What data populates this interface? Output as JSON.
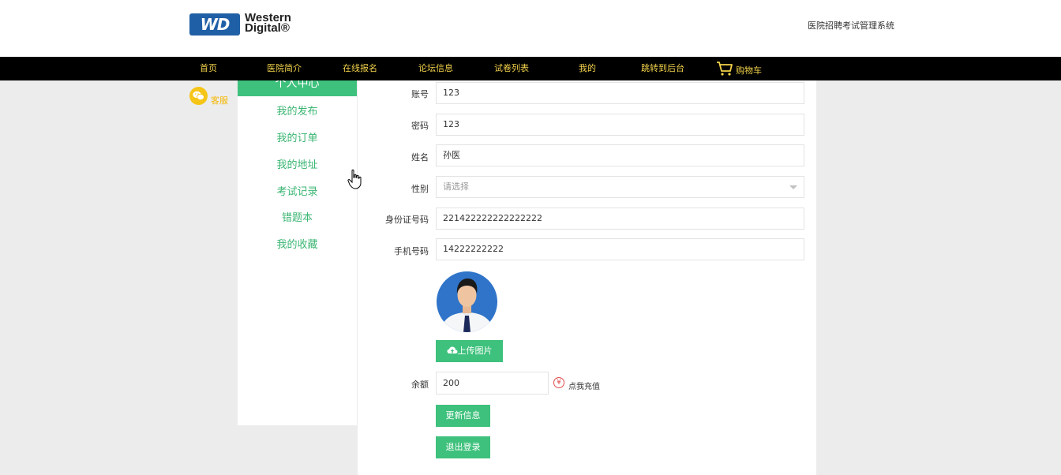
{
  "brand": {
    "logo_badge": "WD",
    "logo_line1": "Western",
    "logo_line2": "Digital®",
    "site_title": "医院招聘考试管理系统"
  },
  "nav": {
    "items": [
      "首页",
      "医院简介",
      "在线报名",
      "论坛信息",
      "试卷列表",
      "我的",
      "跳转到后台",
      "购物车"
    ]
  },
  "service": {
    "label": "客服"
  },
  "sidebar": {
    "active": "个人中心",
    "items": [
      "我的发布",
      "我的订单",
      "我的地址",
      "考试记录",
      "错题本",
      "我的收藏"
    ]
  },
  "form": {
    "account_label": "账号",
    "account_value": "123",
    "password_label": "密码",
    "password_value": "123",
    "name_label": "姓名",
    "name_value": "孙医",
    "gender_label": "性别",
    "gender_placeholder": "请选择",
    "idcard_label": "身份证号码",
    "idcard_value": "221422222222222222",
    "phone_label": "手机号码",
    "phone_value": "14222222222",
    "upload_label": "上传图片",
    "balance_label": "余额",
    "balance_value": "200",
    "recharge_label": "点我充值",
    "update_label": "更新信息",
    "logout_label": "退出登录"
  },
  "colors": {
    "accent": "#3ec17c",
    "nav_bg": "#000000",
    "nav_text": "#f2d24a",
    "service": "#f5c518"
  },
  "icons": {
    "service": "wechat-icon",
    "cart": "cart-icon",
    "upload": "cloud-upload-icon",
    "recharge": "yen-icon"
  }
}
